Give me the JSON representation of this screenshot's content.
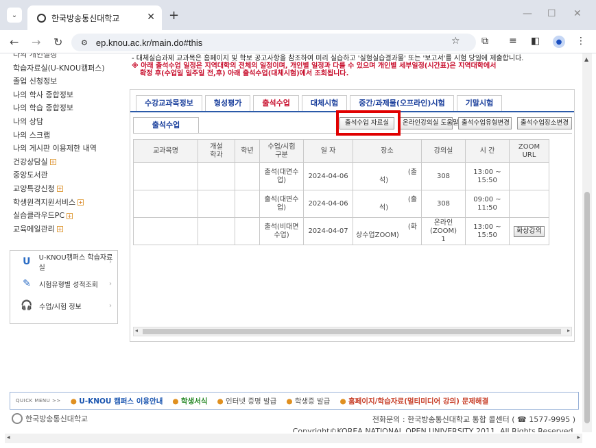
{
  "browser": {
    "tab_title": "한국방송통신대학교",
    "url": "ep.knou.ac.kr/main.do#this"
  },
  "sidebar": {
    "items": [
      {
        "label": "나의 개인설정",
        "plus": false
      },
      {
        "label": "학습자료실(U-KNOU캠퍼스)",
        "plus": false
      },
      {
        "label": "졸업 신청정보",
        "plus": false
      },
      {
        "label": "나의 학사 종합정보",
        "plus": false
      },
      {
        "label": "나의 학습 종합정보",
        "plus": false
      },
      {
        "label": "나의 상담",
        "plus": false
      },
      {
        "label": "나의 스크랩",
        "plus": false
      },
      {
        "label": "나의 게시판 이용제한 내역",
        "plus": false
      },
      {
        "label": "건강상담실",
        "plus": true
      },
      {
        "label": "중앙도서관",
        "plus": false
      },
      {
        "label": "교양특강신청",
        "plus": true
      },
      {
        "label": "학생원격지원서비스",
        "plus": true
      },
      {
        "label": "실습클라우드PC",
        "plus": true
      },
      {
        "label": "교육메일관리",
        "plus": true
      }
    ],
    "quick_box": [
      {
        "label": "U-KNOU캠퍼스 학습자료실",
        "icon": "u-knou-logo-icon"
      },
      {
        "label": "시험유형별 성적조회",
        "icon": "grade-icon"
      },
      {
        "label": "수업/시험 정보",
        "icon": "headset-icon"
      }
    ]
  },
  "notice": {
    "line1": "- 대체실습과제 교과목은 홈페이지 및 학보 공고사항을 참조하여 미리 실습하고 '실험실습결과물' 또는 '보고서'를 시험 당일에 제출합니다.",
    "line2": "※ 아래 출석수업 일정은 지역대학의 전체의 일정이며, 개인별 일정과 다를 수 있으며 개인별 세부일정(시간표)은 지역대학에서",
    "line3": "확정 후(수업일 일주일 전,후) 아래 출석수업(대체시험)에서 조회됩니다."
  },
  "tabs": [
    {
      "label": "수강교과목정보",
      "active": false
    },
    {
      "label": "형성평가",
      "active": false
    },
    {
      "label": "출석수업",
      "active": true
    },
    {
      "label": "대체시험",
      "active": false
    },
    {
      "label": "중간/과제물(오프라인)시험",
      "active": false
    },
    {
      "label": "기말시험",
      "active": false
    }
  ],
  "sub_tab": "출석수업",
  "buttons": {
    "materials": "출석수업 자료실",
    "online_help": "온라인강의실 도움말",
    "type_change": "출석수업유형변경",
    "place_change": "출석수업장소변경"
  },
  "table": {
    "headers": [
      "교과목명",
      "개설\n학과",
      "학년",
      "수업/시험\n구분",
      "일 자",
      "장소",
      "강의실",
      "시 간",
      "ZOOM\nURL"
    ],
    "rows": [
      {
        "course": "",
        "dept": "",
        "grade": "",
        "type": "출석(대면수업)",
        "date": "2024-04-06",
        "place_a": "(출",
        "place_b": "석)",
        "room": "308",
        "time": "13:00 ~\n15:50",
        "zoom": ""
      },
      {
        "course": "",
        "dept": "",
        "grade": "",
        "type": "출석(대면수업)",
        "date": "2024-04-06",
        "place_a": "(출",
        "place_b": "석)",
        "room": "308",
        "time": "09:00 ~\n11:50",
        "zoom": ""
      },
      {
        "course": "",
        "dept": "",
        "grade": "",
        "type": "출석(비대면수업)",
        "date": "2024-04-07",
        "place_a": "(화",
        "place_b": "상수업ZOOM)",
        "room": "온라인(ZOOM)\n1",
        "time": "13:00 ~\n15:50",
        "zoom": "화상강의"
      }
    ]
  },
  "quick_menu": {
    "label": "QUICK MENU  >>",
    "links": [
      {
        "text": "U-KNOU 캠퍼스 이용안내",
        "style": "blue"
      },
      {
        "text": "학생서식",
        "style": "green"
      },
      {
        "text": "인터넷 증명 발급",
        "style": "gray"
      },
      {
        "text": "학생증 발급",
        "style": "gray"
      },
      {
        "text": "홈페이지/학습자료(멀티미디어 강의) 문제해결",
        "style": "red"
      }
    ]
  },
  "footer": {
    "logo_text": "한국방송통신대학교",
    "contact": "전화문의 : 한국방송통신대학교 통합 콜센터 ( ☎ 1577-9995 )",
    "copyright": "Copyright©KOREA NATIONAL OPEN UNIVERSITY 2011. All Rights Reserved."
  }
}
